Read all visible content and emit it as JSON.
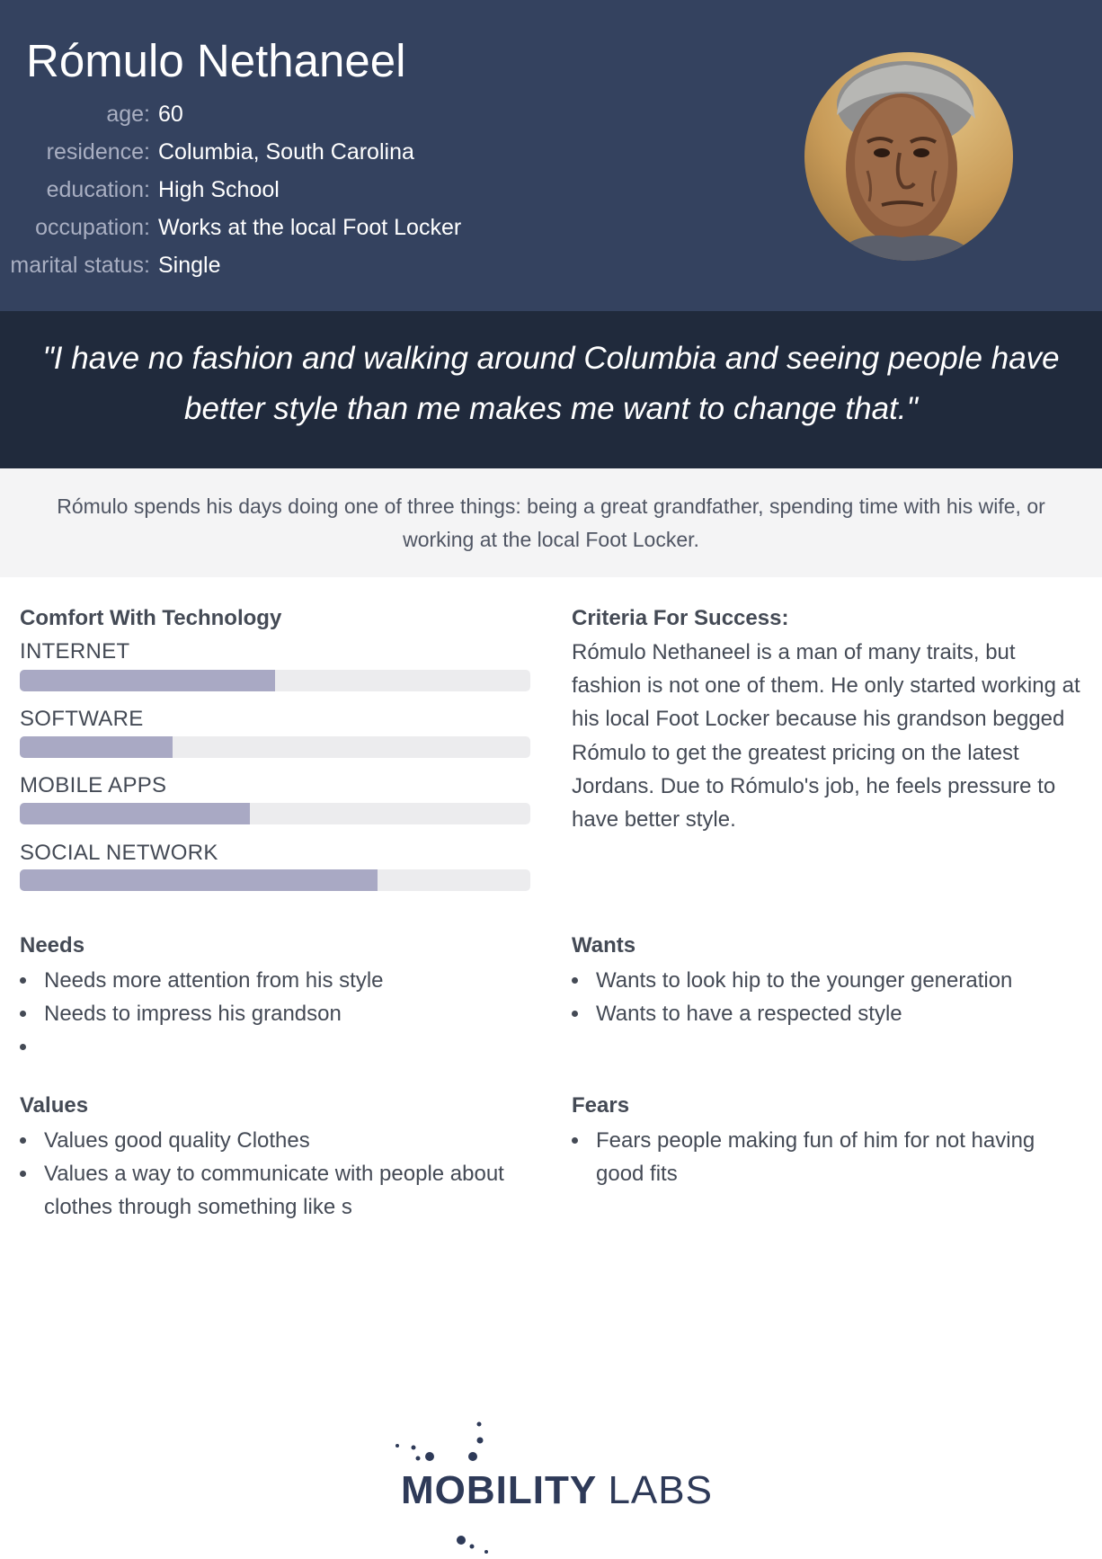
{
  "persona": {
    "name": "Rómulo Nethaneel",
    "facts": [
      {
        "label": "age:",
        "value": "60"
      },
      {
        "label": "residence:",
        "value": "Columbia, South Carolina"
      },
      {
        "label": "education:",
        "value": "High School"
      },
      {
        "label": "occupation:",
        "value": "Works at the local Foot Locker"
      },
      {
        "label": "marital status:",
        "value": "Single"
      }
    ]
  },
  "quote": "\"I have no fashion and walking around Columbia and seeing people have better style than me makes me want to change that.\"",
  "summary": "Rómulo spends his days doing one of three things: being a great grandfather, spending time with his wife, or working at the local Foot Locker.",
  "technology": {
    "title": "Comfort With Technology",
    "items": [
      {
        "label": "INTERNET",
        "level": 0.5
      },
      {
        "label": "SOFTWARE",
        "level": 0.3
      },
      {
        "label": "MOBILE APPS",
        "level": 0.45
      },
      {
        "label": "SOCIAL NETWORK",
        "level": 0.7
      }
    ]
  },
  "criteria": {
    "title": "Criteria For Success:",
    "text": "Rómulo Nethaneel is a man of many traits, but fashion is not one of them. He only started working at his local Foot Locker because his grandson begged Rómulo to get the greatest pricing on the latest Jordans. Due to Rómulo's job, he feels pressure to have better style."
  },
  "needs": {
    "title": "Needs",
    "items": [
      "Needs more attention from his style",
      "Needs to impress his grandson",
      ""
    ]
  },
  "wants": {
    "title": "Wants",
    "items": [
      "Wants to look hip to the younger generation",
      "Wants to have a respected style"
    ]
  },
  "values": {
    "title": "Values",
    "items": [
      "Values good quality Clothes",
      "Values a way to communicate with people about clothes through something like s"
    ]
  },
  "fears": {
    "title": "Fears",
    "items": [
      "Fears people making fun of him for not having good fits"
    ]
  },
  "logo": {
    "bold": "MOBILITY",
    "light": "LABS",
    "color": "#2e3a58"
  }
}
